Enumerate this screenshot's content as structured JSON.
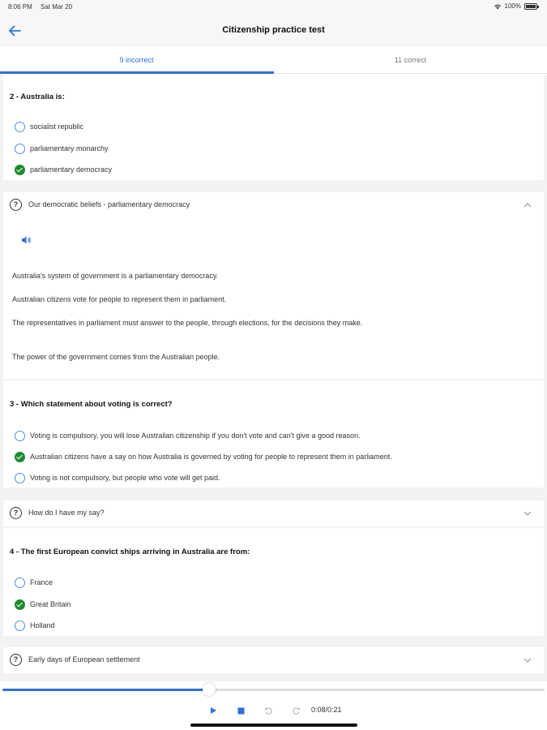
{
  "status_bar": {
    "time": "8:06 PM",
    "date": "Sat Mar 20",
    "battery": "100%"
  },
  "header": {
    "title": "Citizenship practice test",
    "back_icon": "arrow-left-icon"
  },
  "tabs": [
    {
      "label": "9 incorrect",
      "selected": true
    },
    {
      "label": "11 correct",
      "selected": false
    }
  ],
  "colors": {
    "accent": "#2f6fd6",
    "correct": "#1e8a2e"
  },
  "questions": [
    {
      "title": "2 - Australia is:",
      "options": [
        {
          "label": "socialist republic",
          "checked": false
        },
        {
          "label": "parliamentary monarchy",
          "checked": false
        },
        {
          "label": "parliamentary democracy",
          "checked": true
        }
      ],
      "topic": "Our democratic beliefs - parliamentary democracy",
      "expanded": true,
      "explanation": [
        "Australia's system of government is a parliamentary democracy.",
        "Australian citizens vote for people to represent them in parliament.",
        "The representatives in parliament must answer to the people, through elections, for the decisions they make.",
        "The power of the government comes from the Australian people."
      ]
    },
    {
      "title": "3 - Which statement about voting is correct?",
      "options": [
        {
          "label": "Voting is compulsory, you will lose Australian citizenship if you don't vote and can't give a good reason.",
          "checked": false
        },
        {
          "label": "Australian citizens have a say on how Australia is governed by voting for people to represent them in parliament.",
          "checked": true
        },
        {
          "label": "Voting is not compulsory, but people who vote will get paid.",
          "checked": false
        }
      ],
      "topic": "How do I have my say?",
      "expanded": false
    },
    {
      "title": "4 - The first European convict ships arriving in Australia are from:",
      "options": [
        {
          "label": "France",
          "checked": false
        },
        {
          "label": "Great Britain",
          "checked": true
        },
        {
          "label": "Holland",
          "checked": false
        }
      ],
      "topic": "Early days of European settlement",
      "expanded": false
    }
  ],
  "player": {
    "time": "0:08/0:21",
    "progress": 0.381
  }
}
